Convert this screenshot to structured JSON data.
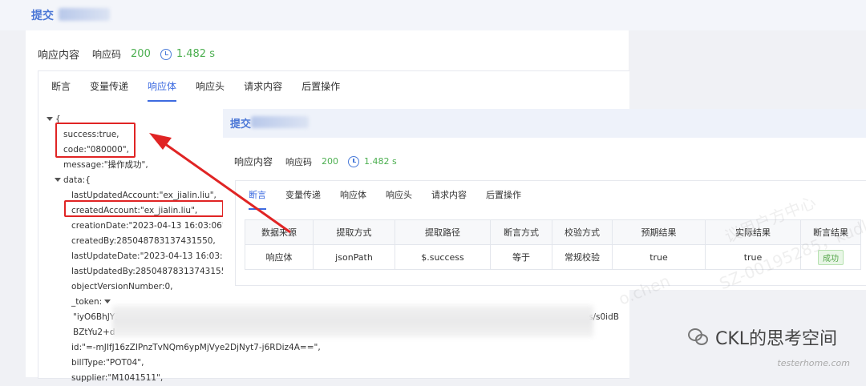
{
  "back": {
    "title": "提交",
    "response_label": "响应内容",
    "code_label": "响应码",
    "code_value": "200",
    "time_value": "1.482 s",
    "tabs": [
      {
        "label": "断言"
      },
      {
        "label": "变量传递"
      },
      {
        "label": "响应体"
      },
      {
        "label": "响应头"
      },
      {
        "label": "请求内容"
      },
      {
        "label": "后置操作"
      }
    ],
    "json_lines": {
      "open": "{",
      "success": "success:true,",
      "code": "code:\"080000\",",
      "message": "message:\"操作成功\",",
      "data": "data:{",
      "lastUpdatedAccount": "lastUpdatedAccount:\"ex_jialin.liu\",",
      "createdAccount": "createdAccount:\"ex_jialin.liu\",",
      "creationDate": "creationDate:\"2023-04-13 16:03:06\",",
      "createdBy": "createdBy:285048783137431550,",
      "lastUpdateDate": "lastUpdateDate:\"2023-04-13 16:03:0",
      "lastUpdatedBy": "lastUpdatedBy:28504878313743155C",
      "objectVersionNumber": "objectVersionNumber:0,",
      "token": "_token:",
      "token_value": "\"iyO6BhJY3zchqylwzVM11K",
      "token_tail": "s/s0idB",
      "token2": "BZtYu2+d",
      "id": "id:\"=-mJIfJ16zZIPnzTvNQm6ypMjVye2DjNyt7-j6RDiz4A==\",",
      "billType": "billType:\"POT04\",",
      "supplier": "supplier:\"M1041511\","
    }
  },
  "front": {
    "title": "提交",
    "response_label": "响应内容",
    "code_label": "响应码",
    "code_value": "200",
    "time_value": "1.482 s",
    "tabs": [
      {
        "label": "断言"
      },
      {
        "label": "变量传递"
      },
      {
        "label": "响应体"
      },
      {
        "label": "响应头"
      },
      {
        "label": "请求内容"
      },
      {
        "label": "后置操作"
      }
    ],
    "table": {
      "headers": [
        "数据来源",
        "提取方式",
        "提取路径",
        "断言方式",
        "校验方式",
        "预期结果",
        "实际结果",
        "断言结果"
      ],
      "row": [
        "响应体",
        "jsonPath",
        "$.success",
        "等于",
        "常规校验",
        "true",
        "true",
        "成功"
      ]
    }
  },
  "watermark": {
    "text1": "SZ-00195285，kudlo",
    "text2": "议用户方中心",
    "text3": "o.chen"
  },
  "brand": {
    "name": "CKL的思考空间",
    "site": "testerhome.com"
  },
  "colors": {
    "accent": "#3d6be0",
    "success": "#4caf50",
    "annotation": "#e02424"
  }
}
